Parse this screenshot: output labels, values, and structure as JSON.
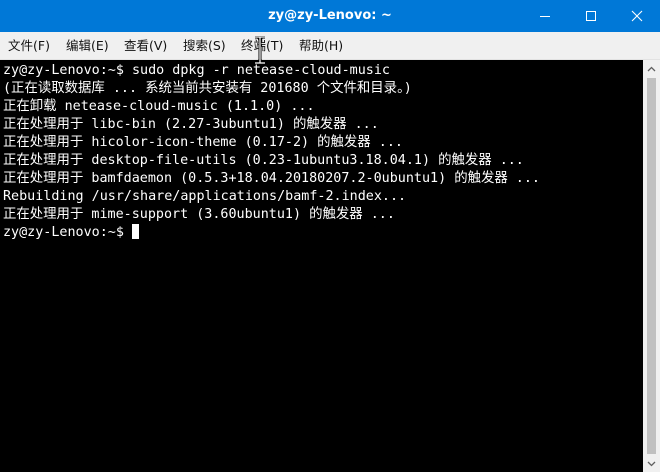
{
  "window": {
    "title": "zy@zy-Lenovo: ~",
    "title_bg": "#0078d7"
  },
  "controls": {
    "minimize_icon": "minimize-icon",
    "maximize_icon": "maximize-icon",
    "close_icon": "close-icon"
  },
  "menu": {
    "items": [
      {
        "label": "文件(F)"
      },
      {
        "label": "编辑(E)"
      },
      {
        "label": "查看(V)"
      },
      {
        "label": "搜索(S)"
      },
      {
        "label": "终端(T)"
      },
      {
        "label": "帮助(H)"
      }
    ]
  },
  "terminal": {
    "bg": "#000000",
    "fg": "#ffffff",
    "lines": [
      "zy@zy-Lenovo:~$ sudo dpkg -r netease-cloud-music",
      "(正在读取数据库 ... 系统当前共安装有 201680 个文件和目录。)",
      "正在卸载 netease-cloud-music (1.1.0) ...",
      "正在处理用于 libc-bin (2.27-3ubuntu1) 的触发器 ...",
      "正在处理用于 hicolor-icon-theme (0.17-2) 的触发器 ...",
      "正在处理用于 desktop-file-utils (0.23-1ubuntu3.18.04.1) 的触发器 ...",
      "正在处理用于 bamfdaemon (0.5.3+18.04.20180207.2-0ubuntu1) 的触发器 ...",
      "Rebuilding /usr/share/applications/bamf-2.index...",
      "正在处理用于 mime-support (3.60ubuntu1) 的触发器 ..."
    ],
    "prompt": "zy@zy-Lenovo:~$ "
  }
}
